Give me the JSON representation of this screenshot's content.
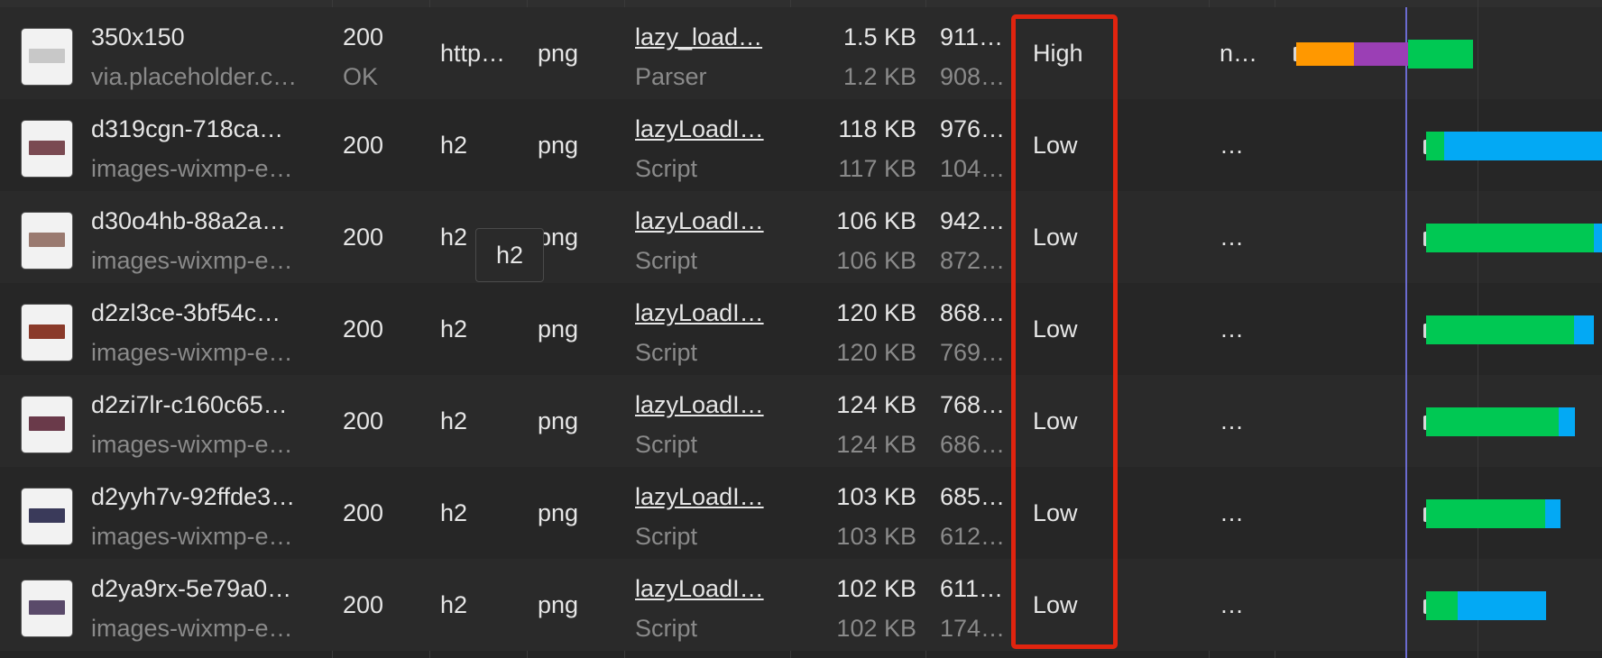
{
  "rows": [
    {
      "name": "350x150",
      "host": "via.placeholder.c…",
      "status": "200",
      "status_text": "OK",
      "protocol": "http…",
      "type": "png",
      "initiator": "lazy_load…",
      "initiator_type": "Parser",
      "size": "1.5 KB",
      "resource_size": "1.2 KB",
      "time": "911…",
      "time_2": "908…",
      "priority": "High",
      "extra": "n…",
      "thumb_color": "#c8c8c8"
    },
    {
      "name": "d319cgn-718ca…",
      "host": "images-wixmp-e…",
      "status": "200",
      "status_text": "",
      "protocol": "h2",
      "type": "png",
      "initiator": "lazyLoadI…",
      "initiator_type": "Script",
      "size": "118 KB",
      "resource_size": "117 KB",
      "time": "976…",
      "time_2": "104…",
      "priority": "Low",
      "extra": "…",
      "thumb_color": "#7a4a52"
    },
    {
      "name": "d30o4hb-88a2a…",
      "host": "images-wixmp-e…",
      "status": "200",
      "status_text": "",
      "protocol": "h2",
      "type": "png",
      "initiator": "lazyLoadI…",
      "initiator_type": "Script",
      "size": "106 KB",
      "resource_size": "106 KB",
      "time": "942…",
      "time_2": "872…",
      "priority": "Low",
      "extra": "…",
      "thumb_color": "#9a7a70"
    },
    {
      "name": "d2zl3ce-3bf54c…",
      "host": "images-wixmp-e…",
      "status": "200",
      "status_text": "",
      "protocol": "h2",
      "type": "png",
      "initiator": "lazyLoadI…",
      "initiator_type": "Script",
      "size": "120 KB",
      "resource_size": "120 KB",
      "time": "868…",
      "time_2": "769…",
      "priority": "Low",
      "extra": "…",
      "thumb_color": "#8a3a2a"
    },
    {
      "name": "d2zi7lr-c160c65…",
      "host": "images-wixmp-e…",
      "status": "200",
      "status_text": "",
      "protocol": "h2",
      "type": "png",
      "initiator": "lazyLoadI…",
      "initiator_type": "Script",
      "size": "124 KB",
      "resource_size": "124 KB",
      "time": "768…",
      "time_2": "686…",
      "priority": "Low",
      "extra": "…",
      "thumb_color": "#6a3a4a"
    },
    {
      "name": "d2yyh7v-92ffde3…",
      "host": "images-wixmp-e…",
      "status": "200",
      "status_text": "",
      "protocol": "h2",
      "type": "png",
      "initiator": "lazyLoadI…",
      "initiator_type": "Script",
      "size": "103 KB",
      "resource_size": "103 KB",
      "time": "685…",
      "time_2": "612…",
      "priority": "Low",
      "extra": "…",
      "thumb_color": "#3a3a5a"
    },
    {
      "name": "d2ya9rx-5e79a0…",
      "host": "images-wixmp-e…",
      "status": "200",
      "status_text": "",
      "protocol": "h2",
      "type": "png",
      "initiator": "lazyLoadI…",
      "initiator_type": "Script",
      "size": "102 KB",
      "resource_size": "102 KB",
      "time": "611…",
      "time_2": "174…",
      "priority": "Low",
      "extra": "…",
      "thumb_color": "#5a4a6a"
    }
  ],
  "tooltip": "h2",
  "colors": {
    "queue": "#ff9800",
    "stalled": "#9b3fb5",
    "waiting": "#00c853",
    "download": "#03a9f4",
    "highlight": "#e0240f"
  }
}
